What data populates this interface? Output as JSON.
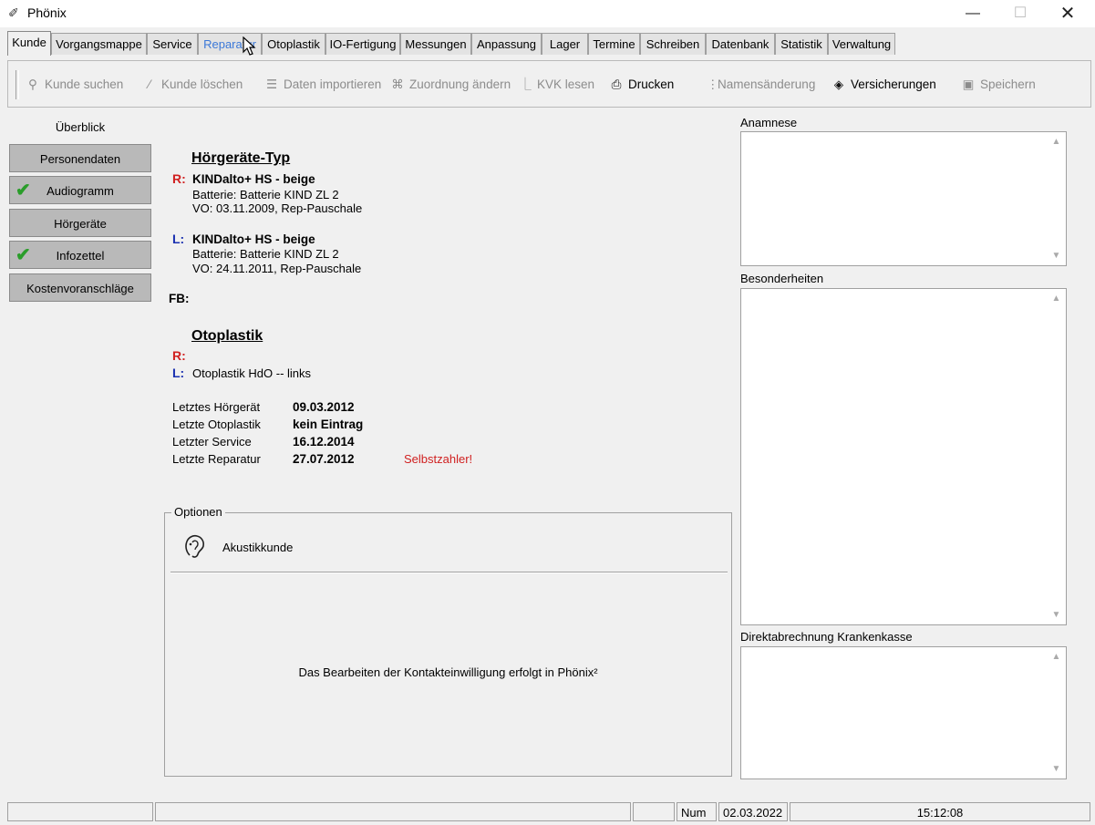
{
  "window": {
    "title": "Phönix",
    "min_glyph": "—",
    "max_glyph": "☐",
    "close_glyph": "✕"
  },
  "tabs": [
    "Kunde",
    "Vorgangsmappe",
    "Service",
    "Reparatur",
    "Otoplastik",
    "IO-Fertigung",
    "Messungen",
    "Anpassung",
    "Lager",
    "Termine",
    "Schreiben",
    "Datenbank",
    "Statistik",
    "Verwaltung"
  ],
  "active_tab": "Kunde",
  "toolbar": {
    "kunde_suchen": "Kunde suchen",
    "kunde_loeschen": "Kunde löschen",
    "daten_importieren": "Daten importieren",
    "zuordnung_aendern": "Zuordnung ändern",
    "kvk_lesen": "KVK lesen",
    "drucken": "Drucken",
    "namensaenderung": "Namensänderung",
    "versicherungen": "Versicherungen",
    "speichern": "Speichern"
  },
  "nav": {
    "ueberblick": "Überblick",
    "personendaten": "Personendaten",
    "audiogramm": "Audiogramm",
    "hoergeraete": "Hörgeräte",
    "infozettel": "Infozettel",
    "kostenvoranschlaege": "Kostenvoranschläge"
  },
  "hoergeraete": {
    "title": "Hörgeräte-Typ",
    "r_marker": "R:",
    "l_marker": "L:",
    "right_model": "KINDalto+ HS - beige",
    "right_battery": "Batterie: Batterie KIND ZL 2",
    "right_vo": "VO: 03.11.2009, Rep-Pauschale",
    "left_model": "KINDalto+ HS - beige",
    "left_battery": "Batterie: Batterie KIND ZL 2",
    "left_vo": "VO: 24.11.2011, Rep-Pauschale",
    "fb_label": "FB:"
  },
  "otoplastik": {
    "title": "Otoplastik",
    "r_marker": "R:",
    "l_marker": "L:",
    "left_value": "Otoplastik HdO -- links"
  },
  "history": {
    "letztes_hoergeraet_label": "Letztes Hörgerät",
    "letztes_hoergeraet": "09.03.2012",
    "letzte_otoplastik_label": "Letzte Otoplastik",
    "letzte_otoplastik": "kein Eintrag",
    "letzter_service_label": "Letzter Service",
    "letzter_service": "16.12.2014",
    "letzte_reparatur_label": "Letzte Reparatur",
    "letzte_reparatur": "27.07.2012",
    "selbstzahler": "Selbstzahler!"
  },
  "optionen": {
    "legend": "Optionen",
    "akustikkunde": "Akustikkunde",
    "hinweis": "Das Bearbeiten der Kontakteinwilligung erfolgt in Phönix²"
  },
  "right_panel": {
    "anamnese": "Anamnese",
    "besonderheiten": "Besonderheiten",
    "direktabrechnung": "Direktabrechnung Krankenkasse"
  },
  "status": {
    "num": "Num",
    "date": "02.03.2022",
    "time": "15:12:08"
  },
  "colors": {
    "red_marker": "#d02020",
    "blue_marker": "#1a30b0",
    "check_green": "#2a9d2a",
    "hover_blue": "#3b78d8"
  }
}
